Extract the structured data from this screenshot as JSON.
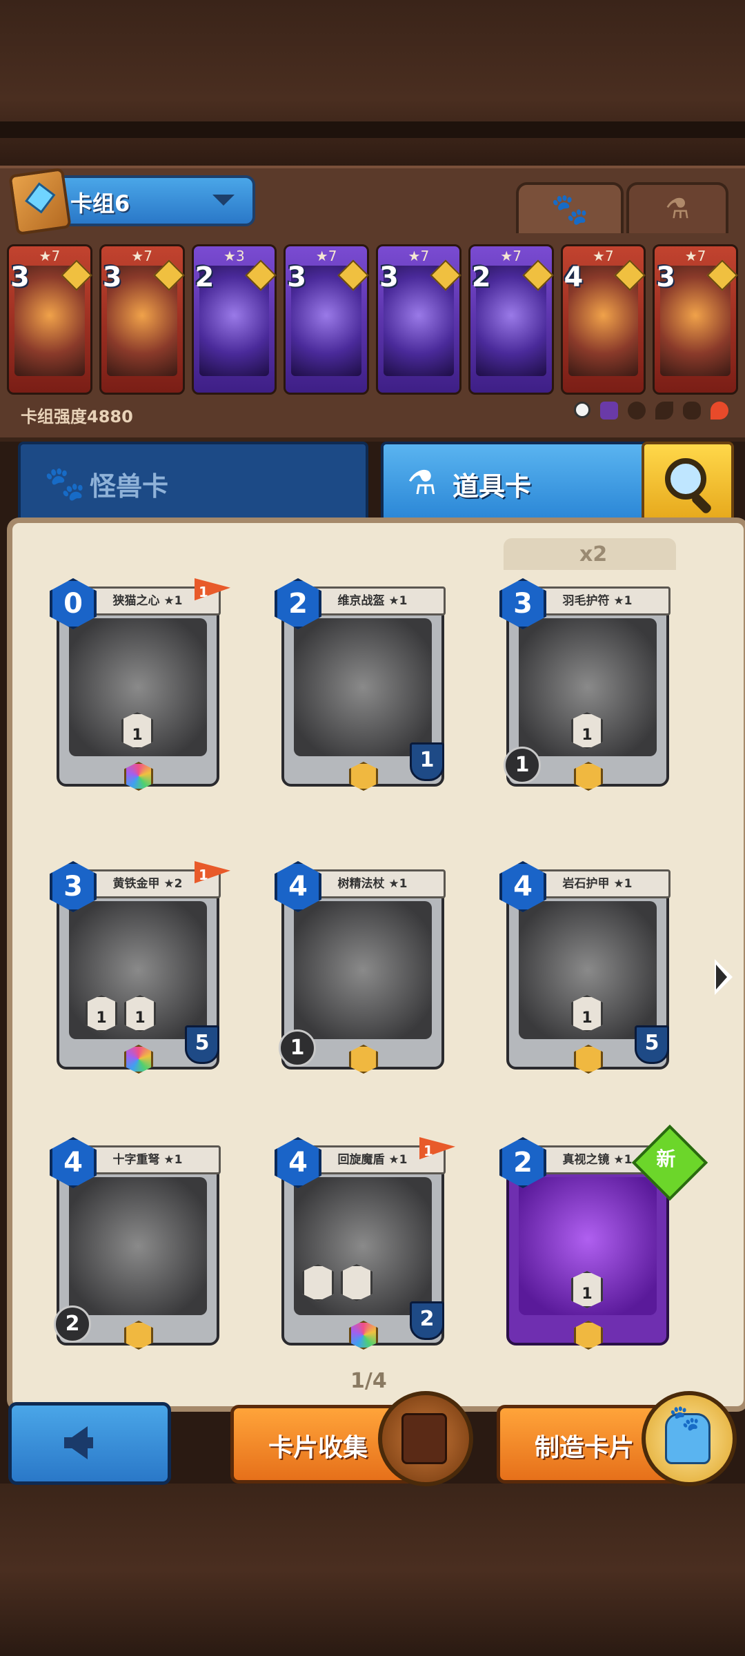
{
  "deck": {
    "selector_label": "卡组6",
    "strength_label": "卡组强度4880",
    "tabs": [
      {
        "icon": "paw-icon",
        "active": true
      },
      {
        "icon": "potion-icon",
        "active": false
      }
    ],
    "cards": [
      {
        "stars": "★7",
        "cost": "3",
        "color": "red"
      },
      {
        "stars": "★7",
        "cost": "3",
        "color": "red"
      },
      {
        "stars": "★3",
        "cost": "2",
        "color": "purple"
      },
      {
        "stars": "★7",
        "cost": "3",
        "color": "purple"
      },
      {
        "stars": "★7",
        "cost": "3",
        "color": "purple"
      },
      {
        "stars": "★7",
        "cost": "2",
        "color": "purple"
      },
      {
        "stars": "★7",
        "cost": "4",
        "color": "red"
      },
      {
        "stars": "★7",
        "cost": "3",
        "color": "red"
      }
    ]
  },
  "category_tabs": {
    "monster": "怪兽卡",
    "item": "道具卡",
    "active": "item"
  },
  "collection": {
    "duplicate_label": "x2",
    "page": "1/4",
    "cards": [
      {
        "name": "狭猫之心 ★1",
        "cost": "0",
        "flag": "1",
        "skills": [
          "1"
        ],
        "gem": "rainbow"
      },
      {
        "name": "维京战盔 ★1",
        "cost": "2",
        "shield": "1",
        "gem": "gold"
      },
      {
        "name": "羽毛护符 ★1",
        "cost": "3",
        "sword": "1",
        "skills": [
          "1"
        ],
        "gem": "gold"
      },
      {
        "name": "黄铁金甲 ★2",
        "cost": "3",
        "flag": "1",
        "shield": "5",
        "skills": [
          "1",
          "1"
        ],
        "gem": "rainbow"
      },
      {
        "name": "树精法杖 ★1",
        "cost": "4",
        "sword": "1",
        "gem": "gold"
      },
      {
        "name": "岩石护甲 ★1",
        "cost": "4",
        "shield": "5",
        "skills": [
          "1"
        ],
        "gem": "gold"
      },
      {
        "name": "十字重弩 ★1",
        "cost": "4",
        "sword": "2",
        "gem": "gold"
      },
      {
        "name": "回旋魔盾 ★1",
        "cost": "4",
        "flag": "1",
        "shield": "2",
        "gem": "rainbow"
      },
      {
        "name": "真视之镜 ★1",
        "cost": "2",
        "skills": [
          "1"
        ],
        "gem": "gold",
        "new_label": "新",
        "purple": true
      }
    ]
  },
  "buttons": {
    "back_icon": "back-arrow-icon",
    "collect": "卡片收集",
    "craft": "制造卡片"
  }
}
